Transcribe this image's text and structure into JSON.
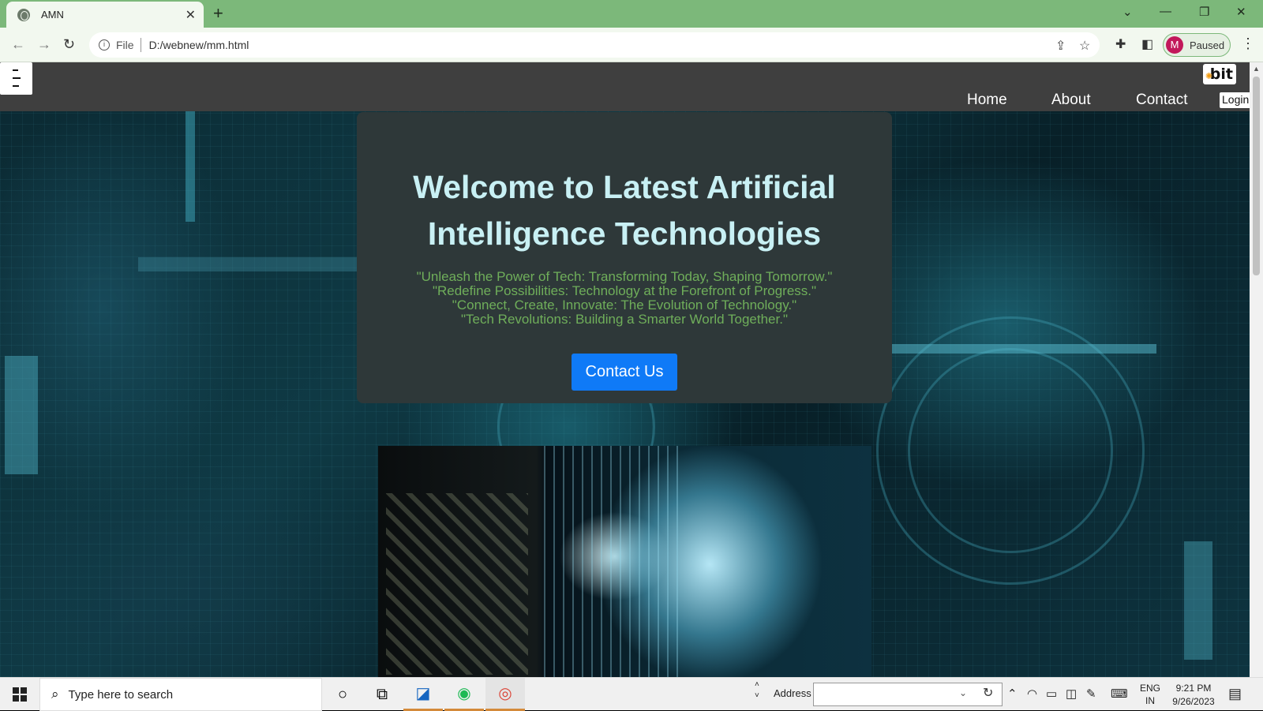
{
  "browser": {
    "tab_title": "AMN",
    "tab_close": "✕",
    "new_tab": "+",
    "url_scheme": "File",
    "url": "D:/webnew/mm.html",
    "profile_initial": "M",
    "profile_status": "Paused"
  },
  "site": {
    "logo_text": "bit",
    "nav": [
      "Home",
      "About",
      "Contact"
    ],
    "login": "Login"
  },
  "hero": {
    "title_line1": "Welcome to Latest Artificial",
    "title_line2": "Intelligence Technologies",
    "quotes": [
      "\"Unleash the Power of Tech: Transforming Today, Shaping Tomorrow.\"",
      "\"Redefine Possibilities: Technology at the Forefront of Progress.\"",
      "\"Connect, Create, Innovate: The Evolution of Technology.\"",
      "\"Tech Revolutions: Building a Smarter World Together.\""
    ],
    "cta": "Contact Us"
  },
  "taskbar": {
    "search_placeholder": "Type here to search",
    "address_label": "Address",
    "address_value": "",
    "lang_line1": "ENG",
    "lang_line2": "IN",
    "time": "9:21 PM",
    "date": "9/26/2023"
  },
  "colors": {
    "tab_strip": "#7cb87a",
    "navbar": "#3f3f3f",
    "hero_card": "#2e3839",
    "hero_title": "#c8f0f4",
    "quote_text": "#6fae5a",
    "cta_button": "#0f7af7"
  },
  "icons": [
    "globe-icon",
    "back-icon",
    "forward-icon",
    "reload-icon",
    "info-icon",
    "share-icon",
    "star-icon",
    "extensions-icon",
    "sidepanel-icon",
    "menu-icon",
    "hamburger-icon",
    "windows-icon",
    "search-icon",
    "cortana-icon",
    "task-view-icon",
    "chrome-icon",
    "spotify-icon",
    "notification-icon"
  ]
}
